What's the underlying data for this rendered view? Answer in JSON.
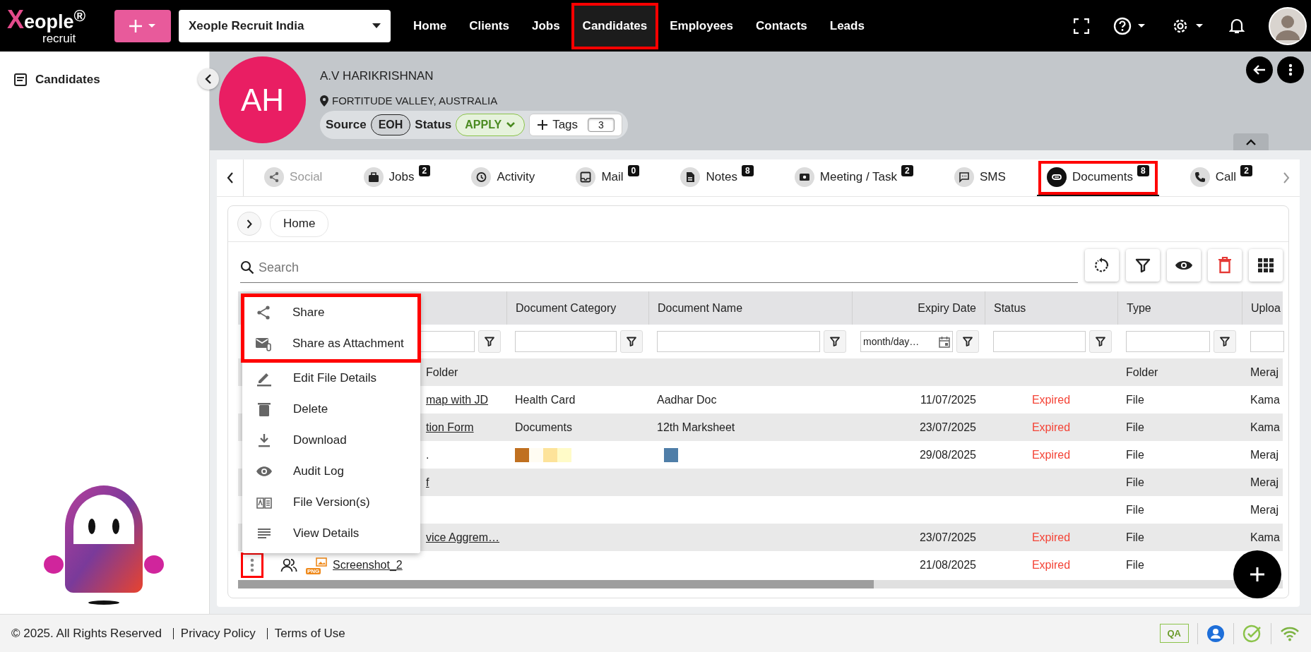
{
  "app": {
    "logo": "Xeople$^{®}$",
    "logo_sub": "recruit",
    "org_select": "Xeople Recruit India"
  },
  "nav": [
    {
      "label": "Home",
      "selected": false,
      "highlighted": false
    },
    {
      "label": "Clients",
      "selected": false,
      "highlighted": false
    },
    {
      "label": "Jobs",
      "selected": false,
      "highlighted": false
    },
    {
      "label": "Candidates",
      "selected": true,
      "highlighted": true
    },
    {
      "label": "Employees",
      "selected": false,
      "highlighted": false
    },
    {
      "label": "Contacts",
      "selected": false,
      "highlighted": false
    },
    {
      "label": "Leads",
      "selected": false,
      "highlighted": false
    }
  ],
  "sidebar": {
    "items": [
      {
        "label": "Candidates"
      }
    ]
  },
  "candidate": {
    "initials": "AH",
    "name": "A.V HARIKRISHNAN",
    "location": "FORTITUDE VALLEY, AUSTRALIA",
    "source_label": "Source",
    "source": "EOH",
    "status_label": "Status",
    "status": "APPLY",
    "tags_label": "Tags",
    "tags_count": "3"
  },
  "tabs": [
    {
      "label": "Social",
      "selected": false,
      "disabled": true,
      "highlighted": false
    },
    {
      "label": "Jobs",
      "badge": "2",
      "selected": false,
      "disabled": false,
      "highlighted": false
    },
    {
      "label": "Activity",
      "selected": false,
      "disabled": false,
      "highlighted": false
    },
    {
      "label": "Mail",
      "badge": "0",
      "selected": false,
      "disabled": false,
      "highlighted": false
    },
    {
      "label": "Notes",
      "badge": "8",
      "selected": false,
      "disabled": false,
      "highlighted": false
    },
    {
      "label": "Meeting / Task",
      "badge": "2",
      "selected": false,
      "disabled": false,
      "highlighted": false
    },
    {
      "label": "SMS",
      "selected": false,
      "disabled": false,
      "highlighted": false
    },
    {
      "label": "Documents",
      "badge": "8",
      "selected": true,
      "disabled": false,
      "highlighted": true
    },
    {
      "label": "Call",
      "badge": "2",
      "selected": false,
      "disabled": false,
      "highlighted": false
    }
  ],
  "documents": {
    "breadcrumb": "Home",
    "search": {
      "placeholder": "Search"
    },
    "columns": [
      {
        "label": "Document Category"
      },
      {
        "label": "Document Name"
      },
      {
        "label": "Expiry Date"
      },
      {
        "label": "Status"
      },
      {
        "label": "Type"
      },
      {
        "label": "Uploa"
      }
    ],
    "date_filter_placeholder": "month/day…",
    "rows": [
      {
        "kind": "covered",
        "name": "Folder",
        "link": false,
        "category": "",
        "document": "",
        "expiry": "",
        "status": "",
        "type": "Folder",
        "uploaded_by": "Meraj"
      },
      {
        "kind": "covered",
        "name": "map with JD",
        "link": true,
        "category": "Health Card",
        "document": "Aadhar Doc",
        "expiry": "11/07/2025",
        "status": "Expired",
        "type": "File",
        "uploaded_by": "Kama"
      },
      {
        "kind": "covered",
        "name": "tion Form",
        "link": true,
        "category": "Documents",
        "document": "12th Marksheet",
        "expiry": "23/07/2025",
        "status": "Expired",
        "type": "File",
        "uploaded_by": "Kama"
      },
      {
        "kind": "covered",
        "name": ".",
        "link": false,
        "category_image": true,
        "document_image": true,
        "expiry": "29/08/2025",
        "status": "Expired",
        "type": "File",
        "uploaded_by": "Meraj"
      },
      {
        "kind": "covered",
        "name": "f",
        "link": true,
        "type": "File",
        "uploaded_by": "Meraj"
      },
      {
        "kind": "covered",
        "type": "File",
        "uploaded_by": "Meraj"
      },
      {
        "kind": "covered",
        "name": "vice Aggrem…",
        "link": true,
        "expiry": "23/07/2025",
        "status": "Expired",
        "type": "File",
        "uploaded_by": "Kama"
      },
      {
        "kind": "file",
        "name": "Screenshot_2",
        "file_badge": "PNG",
        "link": true,
        "expiry": "21/08/2025",
        "status": "Expired",
        "type": "File",
        "menu_open": true
      }
    ],
    "menu": {
      "highlighted_items": [
        {
          "label": "Share"
        },
        {
          "label": "Share as Attachment"
        }
      ],
      "items": [
        {
          "label": "Edit File Details"
        },
        {
          "label": "Delete"
        },
        {
          "label": "Download"
        },
        {
          "label": "Audit Log"
        },
        {
          "label": "File Version(s)"
        },
        {
          "label": "View Details"
        }
      ]
    }
  },
  "footer": {
    "copyright": "© 2025. All Rights Reserved",
    "links": [
      "Privacy Policy",
      "Terms of Use"
    ],
    "env_badge": "QA"
  }
}
